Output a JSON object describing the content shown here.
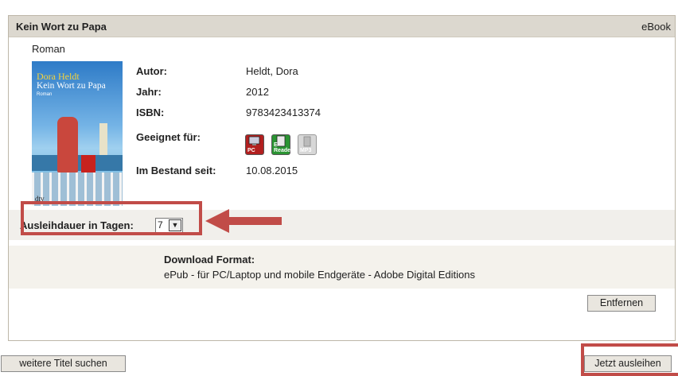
{
  "book": {
    "title": "Kein Wort zu Papa",
    "format_label": "eBook",
    "genre": "Roman",
    "cover": {
      "author": "Dora Heldt",
      "title": "Kein Wort zu Papa",
      "subtitle": "Roman",
      "publisher": "dtv"
    },
    "details": [
      {
        "label": "Autor:",
        "value": "Heldt, Dora"
      },
      {
        "label": "Jahr:",
        "value": "2012"
      },
      {
        "label": "ISBN:",
        "value": "9783423413374"
      },
      {
        "label": "Geeignet für:",
        "value": ""
      },
      {
        "label": "Im Bestand seit:",
        "value": "10.08.2015"
      }
    ],
    "suitable_for": [
      {
        "name": "PC",
        "icon": "pc-icon",
        "color": "#b21f1f"
      },
      {
        "name": "E-Reader",
        "icon": "ereader-icon",
        "color": "#2a9432"
      },
      {
        "name": "MP3",
        "icon": "mp3-icon",
        "color": "#d7d7d7"
      }
    ]
  },
  "loan": {
    "label": "Ausleihdauer in Tagen:",
    "selected_days": "7"
  },
  "download": {
    "label": "Download Format:",
    "value": "ePub - für PC/Laptop und mobile Endgeräte - Adobe Digital Editions"
  },
  "buttons": {
    "remove": "Entfernen",
    "more_titles": "weitere Titel suchen",
    "borrow": "Jetzt ausleihen"
  },
  "colors": {
    "header_bg": "#dcd8cf",
    "highlight": "#c14c48"
  }
}
